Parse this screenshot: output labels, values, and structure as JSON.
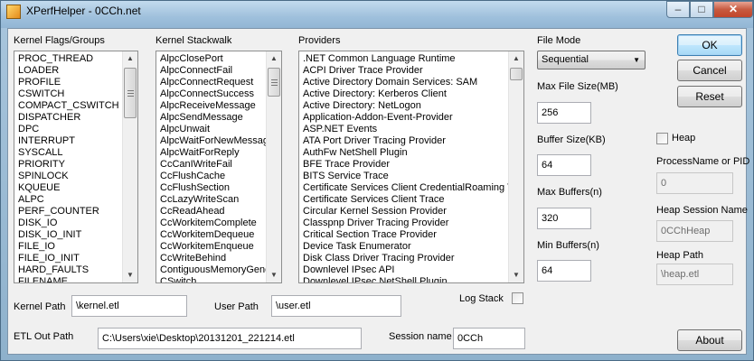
{
  "window": {
    "title": "XPerfHelper - 0CCh.net"
  },
  "titlebar_buttons": {
    "minimize": "–",
    "maximize": "□",
    "close": "✕"
  },
  "kernel_flags": {
    "label": "Kernel Flags/Groups",
    "items": [
      "PROC_THREAD",
      "LOADER",
      "PROFILE",
      "CSWITCH",
      "COMPACT_CSWITCH",
      "DISPATCHER",
      "DPC",
      "INTERRUPT",
      "SYSCALL",
      "PRIORITY",
      "SPINLOCK",
      "KQUEUE",
      "ALPC",
      "PERF_COUNTER",
      "DISK_IO",
      "DISK_IO_INIT",
      "FILE_IO",
      "FILE_IO_INIT",
      "HARD_FAULTS",
      "FILENAME"
    ]
  },
  "kernel_stackwalk": {
    "label": "Kernel Stackwalk",
    "items": [
      "AlpcClosePort",
      "AlpcConnectFail",
      "AlpcConnectRequest",
      "AlpcConnectSuccess",
      "AlpcReceiveMessage",
      "AlpcSendMessage",
      "AlpcUnwait",
      "AlpcWaitForNewMessag",
      "AlpcWaitForReply",
      "CcCanIWriteFail",
      "CcFlushCache",
      "CcFlushSection",
      "CcLazyWriteScan",
      "CcReadAhead",
      "CcWorkitemComplete",
      "CcWorkitemDequeue",
      "CcWorkitemEnqueue",
      "CcWriteBehind",
      "ContiguousMemoryGene",
      "CSwitch"
    ]
  },
  "providers": {
    "label": "Providers",
    "items": [
      ".NET Common Language Runtime",
      "ACPI Driver Trace Provider",
      "Active Directory Domain Services: SAM",
      "Active Directory: Kerberos Client",
      "Active Directory: NetLogon",
      "Application-Addon-Event-Provider",
      "ASP.NET Events",
      "ATA Port Driver Tracing Provider",
      "AuthFw NetShell Plugin",
      "BFE Trace Provider",
      "BITS Service Trace",
      "Certificate Services Client CredentialRoaming Tr",
      "Certificate Services Client Trace",
      "Circular Kernel Session Provider",
      "Classpnp Driver Tracing Provider",
      "Critical Section Trace Provider",
      "Device Task Enumerator",
      "Disk Class Driver Tracing Provider",
      "Downlevel IPsec API",
      "Downlevel IPsec NetShell Plugin"
    ]
  },
  "file_mode": {
    "label": "File Mode",
    "value": "Sequential"
  },
  "max_file_size": {
    "label": "Max File Size(MB)",
    "value": "256"
  },
  "buffer_size": {
    "label": "Buffer Size(KB)",
    "value": "64"
  },
  "max_buffers": {
    "label": "Max Buffers(n)",
    "value": "320"
  },
  "min_buffers": {
    "label": "Min Buffers(n)",
    "value": "64"
  },
  "buttons": {
    "ok": "OK",
    "cancel": "Cancel",
    "reset": "Reset",
    "about": "About"
  },
  "heap": {
    "checkbox_label": "Heap",
    "process_label": "ProcessName or PID",
    "process_value": "0",
    "session_label": "Heap Session Name",
    "session_value": "0CChHeap",
    "path_label": "Heap Path",
    "path_value": "\\heap.etl"
  },
  "kernel_path": {
    "label": "Kernel Path",
    "value": "\\kernel.etl"
  },
  "user_path": {
    "label": "User Path",
    "value": "\\user.etl"
  },
  "log_stack": {
    "label": "Log Stack"
  },
  "etl_out_path": {
    "label": "ETL Out Path",
    "value": "C:\\Users\\xie\\Desktop\\20131201_221214.etl"
  },
  "session_name": {
    "label": "Session name",
    "value": "0CCh"
  }
}
